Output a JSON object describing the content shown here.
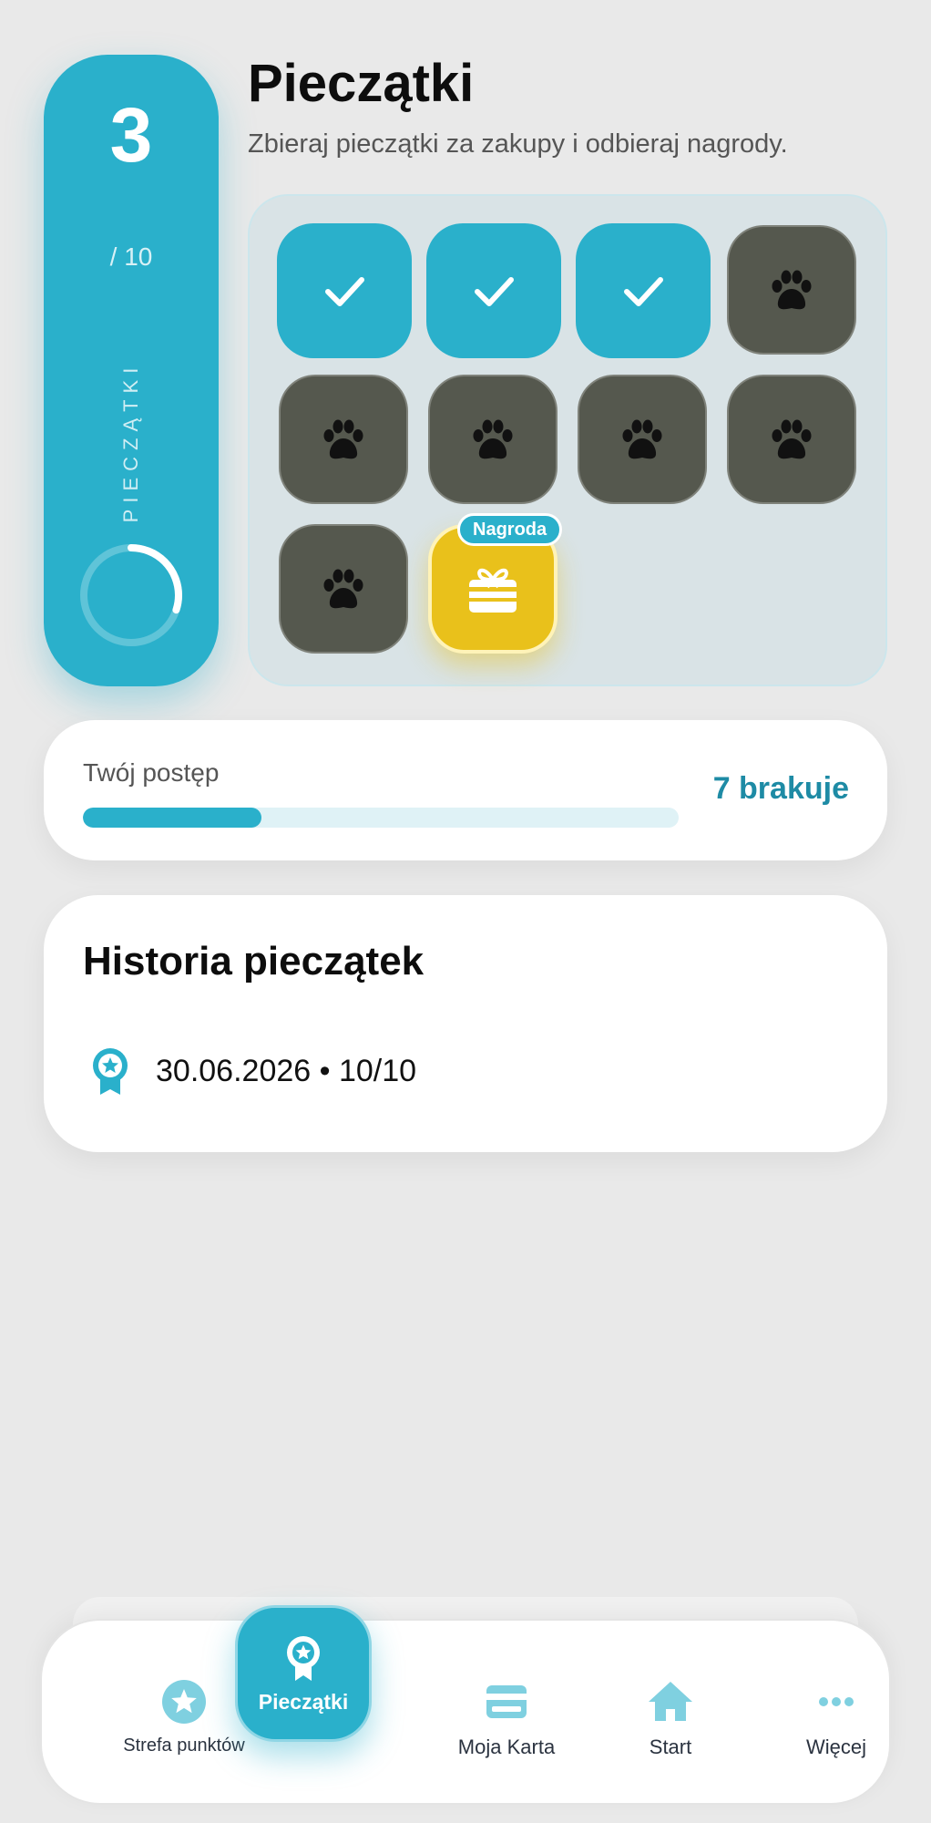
{
  "header": {
    "title": "Pieczątki",
    "subtitle": "Zbieraj pieczątki za zakupy i odbieraj nagrody."
  },
  "counter": {
    "value": "3",
    "total": "/ 10",
    "label": "PIECZĄTKI",
    "progress_fraction": 0.3
  },
  "stamp_card": {
    "collected": 3,
    "total": 10,
    "icons": {
      "collected": "check-icon",
      "empty": "paw-icon",
      "reward": "gift-card-icon"
    },
    "reward_badge": "Nagroda"
  },
  "progress": {
    "label": "Twój postęp",
    "missing": "7 brakuje",
    "fraction": 0.3
  },
  "history": {
    "title": "Historia pieczątek",
    "entries": [
      {
        "icon": "award-ribbon-icon",
        "text": "30.06.2026 • 10/10"
      }
    ]
  },
  "nav": {
    "items": [
      {
        "id": "points",
        "icon": "star-circle-icon",
        "label": "Strefa punktów"
      },
      {
        "id": "stamps",
        "icon": "award-ribbon-icon",
        "label": "Pieczątki",
        "active": true
      },
      {
        "id": "card",
        "icon": "credit-card-icon",
        "label": "Moja Karta"
      },
      {
        "id": "start",
        "icon": "home-icon",
        "label": "Start"
      },
      {
        "id": "more",
        "icon": "more-dots-icon",
        "label": "Więcej"
      }
    ]
  },
  "colors": {
    "accent": "#2ab0cb",
    "accent_dark": "#1e8ba5",
    "stamp_empty": "#55584e",
    "reward": "#e9c11b",
    "background": "#e9e9e9"
  }
}
